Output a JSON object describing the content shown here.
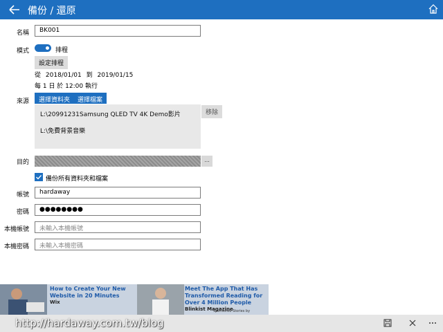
{
  "header": {
    "title": "備份 / 還原",
    "back_icon": "arrow-left-icon",
    "home_icon": "home-icon"
  },
  "form": {
    "name_label": "名稱",
    "name_value": "BK001",
    "mode_label": "模式",
    "mode_toggle_label": "排程",
    "mode_on": true,
    "schedule_button": "設定排程",
    "date_from": "從",
    "date_start": "2018/01/01",
    "date_to": "到",
    "date_end": "2019/01/15",
    "run_every": "每 1 日 於 12:00 執行",
    "source_label": "來源",
    "choose_folder": "選擇資料夾",
    "choose_file": "選擇檔案",
    "source_items": [
      "L:\\20991231Samsung QLED TV 4K Demo影片",
      "L:\\免費背景音樂"
    ],
    "remove_button": "移除",
    "dest_label": "目的",
    "dest_browse": "...",
    "backup_all_label": "備份所有資料夾和檔案",
    "backup_all_checked": true,
    "account_label": "帳號",
    "account_value": "hardaway",
    "password_label": "密碼",
    "password_value": "●●●●●●●●",
    "local_account_label": "本機帳號",
    "local_account_placeholder": "未輸入本機帳號",
    "local_password_label": "本機密碼",
    "local_password_placeholder": "未輸入本機密碼"
  },
  "ads": [
    {
      "headline": "How to Create Your New Website in 20 Minutes",
      "source": "Wix"
    },
    {
      "headline": "Meet The App That Has Transformed Reading for Over 4 Million People",
      "source": "Blinkist Magazine"
    }
  ],
  "sponsored": "Sponsored Stories by",
  "bottombar": {
    "url": "http://hardaway.com.tw/blog",
    "save_icon": "save-icon",
    "close_icon": "close-icon",
    "more_icon": "more-icon"
  },
  "colors": {
    "accent": "#1e6fc0",
    "source_box": "#e8e8e8",
    "bottom_bar": "#e6e6e6"
  }
}
